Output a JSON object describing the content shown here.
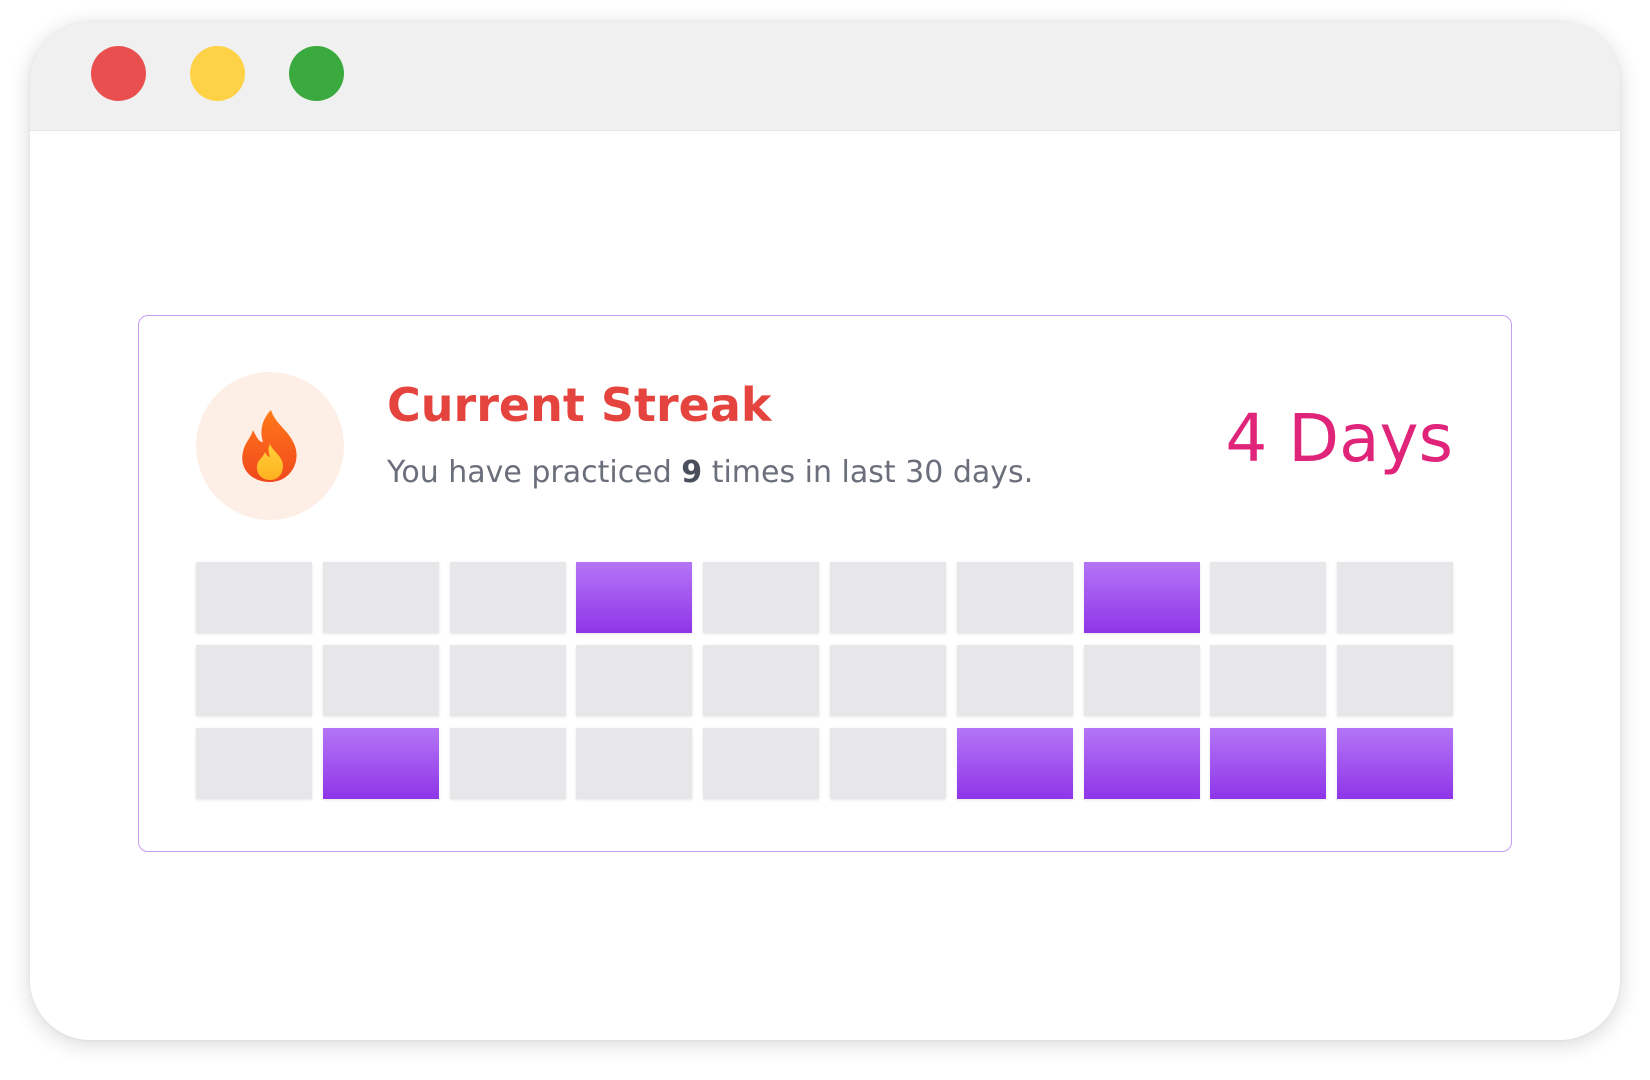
{
  "window": {
    "controls": [
      {
        "name": "close",
        "color": "#e94f4f"
      },
      {
        "name": "minimize",
        "color": "#fdd247"
      },
      {
        "name": "maximize",
        "color": "#3aa93e"
      }
    ]
  },
  "streak_card": {
    "icon": "fire-icon",
    "title": "Current Streak",
    "subtitle_prefix": "You have practiced ",
    "practice_count": "9",
    "subtitle_suffix": " times in last 30 days.",
    "streak_value": "4 Days",
    "colors": {
      "title": "#e5443e",
      "streak_value": "#e0247a",
      "border": "#c59ef0",
      "active_top": "#b475f6",
      "active_bottom": "#8f35e8",
      "inactive": "#e7e7ea"
    },
    "days": [
      0,
      0,
      0,
      1,
      0,
      0,
      0,
      1,
      0,
      0,
      0,
      0,
      0,
      0,
      0,
      0,
      0,
      0,
      0,
      0,
      0,
      1,
      0,
      0,
      0,
      0,
      1,
      1,
      1,
      1
    ]
  }
}
